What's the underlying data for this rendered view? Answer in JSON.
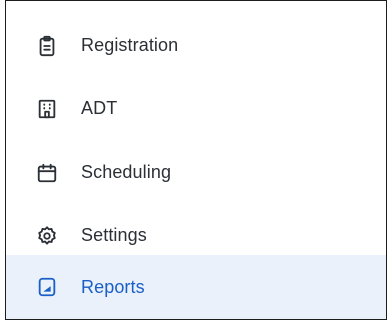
{
  "nav": {
    "items": [
      {
        "label": "Registration",
        "icon": "clipboard-icon",
        "active": false
      },
      {
        "label": "ADT",
        "icon": "building-icon",
        "active": false
      },
      {
        "label": "Scheduling",
        "icon": "calendar-icon",
        "active": false
      },
      {
        "label": "Settings",
        "icon": "gear-icon",
        "active": false
      },
      {
        "label": "Reports",
        "icon": "report-icon",
        "active": true
      }
    ]
  },
  "colors": {
    "text": "#2b2f36",
    "active_text": "#1a5fc8",
    "active_background": "#eaf1fb",
    "border": "#1c1c1c"
  }
}
